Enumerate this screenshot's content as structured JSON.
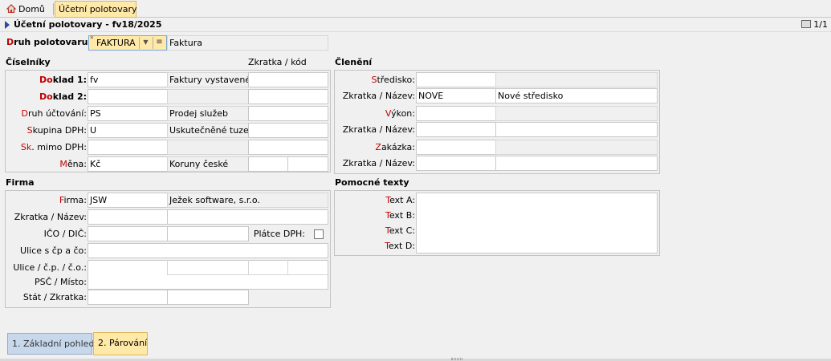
{
  "tabs": {
    "home": "Domů",
    "active": "Účetní polotovary"
  },
  "title": "Účetní polotovary - fv18/2025",
  "pager": "1/1",
  "druh": {
    "label_r": "D",
    "label_rest": "ruh polotovaru:",
    "star": "*",
    "value": "FAKTURA",
    "desc": "Faktura"
  },
  "ciselniky": {
    "heading": "Číselníky",
    "col_zkratka": "Zkratka / kód",
    "doklad1": {
      "label_r": "Do",
      "label_rest": "klad 1:",
      "code": "fv",
      "name": "Faktury vystavené",
      "zk": ""
    },
    "doklad2": {
      "label_r": "Do",
      "label_rest": "klad 2:",
      "code": "",
      "name": "",
      "zk": ""
    },
    "druh_uct": {
      "label_r": "D",
      "label_rest": "ruh účtování:",
      "code": "PS",
      "name": "Prodej služeb",
      "zk": ""
    },
    "skupina": {
      "label_r": "S",
      "label_rest": "kupina DPH:",
      "code": "U",
      "name": "Uskutečněné tuzen",
      "zk": ""
    },
    "mimo": {
      "label_r": "Sk",
      "label_rest": ". mimo DPH:",
      "code": "",
      "name": "",
      "zk": ""
    },
    "mena": {
      "label_r": "M",
      "label_rest": "ěna:",
      "code": "Kč",
      "name": "Koruny české",
      "zk1": "",
      "zk2": ""
    }
  },
  "firma": {
    "heading": "Firma",
    "firma": {
      "label_r": "F",
      "label_rest": "irma:",
      "code": "JSW",
      "name": "Ježek software, s.r.o."
    },
    "zkratka_label": "Zkratka / Název:",
    "ico_label": "IČO / DIČ:",
    "platce_label": "Plátce DPH:",
    "ulice_cp_label": "Ulice s čp a čo:",
    "ulice_label": "Ulice / č.p. / č.o.:",
    "psc_label": "PSČ / Místo:",
    "stat_label": "Stát / Zkratka:"
  },
  "cleneni": {
    "heading": "Členění",
    "stredisko": {
      "label_r": "S",
      "label_rest": "tředisko:"
    },
    "zk1": {
      "label": "Zkratka / Název:",
      "code": "NOVE",
      "name": "Nové středisko"
    },
    "vykon": {
      "label_r": "V",
      "label_rest": "ýkon:"
    },
    "zk2": {
      "label": "Zkratka / Název:",
      "code": "",
      "name": ""
    },
    "zakazka": {
      "label_r": "Z",
      "label_rest": "akázka:"
    },
    "zk3": {
      "label": "Zkratka / Název:",
      "code": "",
      "name": ""
    }
  },
  "pomocne": {
    "heading": "Pomocné texty",
    "a": {
      "label_r": "T",
      "label_rest": "ext A:"
    },
    "b": {
      "label_r": "T",
      "label_rest": "ext B:"
    },
    "c": {
      "label_r": "T",
      "label_rest": "ext C:"
    },
    "d": {
      "label_r": "T",
      "label_rest": "ext D:"
    }
  },
  "bottom_tabs": {
    "t1": "1. Základní pohled",
    "t2": "2. Párování"
  }
}
